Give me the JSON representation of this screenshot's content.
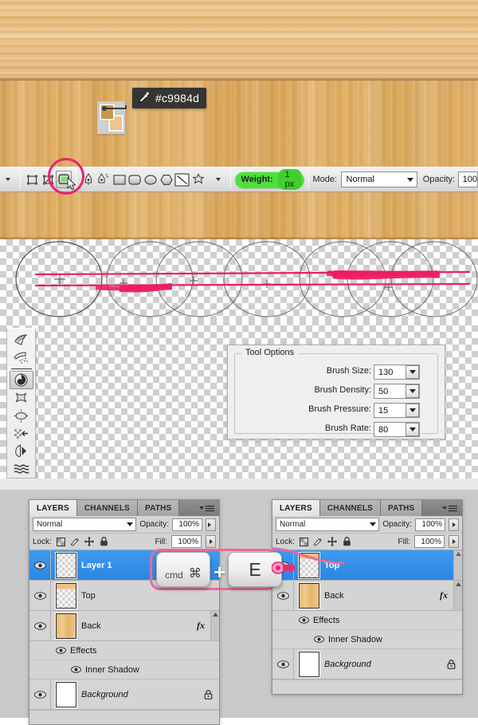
{
  "wood": {
    "top_color": "#eec08a",
    "main_color": "#dfad62"
  },
  "eyedropper": {
    "icon": "eyedropper-icon",
    "hex_value": "#c9984d",
    "foreground_color": "#c9984d",
    "background_color": "#eec58b"
  },
  "options_bar": {
    "preset_caret": "chevron-down-icon",
    "shape_tools": [
      {
        "name": "rectangular-marquee-tool",
        "selected": false
      },
      {
        "name": "transform-path-tool",
        "selected": false
      },
      {
        "name": "rounded-shape-tool",
        "selected": true
      },
      {
        "name": "pen-tool",
        "selected": false
      },
      {
        "name": "freeform-pen-tool",
        "selected": false
      },
      {
        "name": "rectangle-tool",
        "selected": false
      },
      {
        "name": "rounded-rectangle-tool",
        "selected": false
      },
      {
        "name": "ellipse-tool",
        "selected": false
      },
      {
        "name": "polygon-tool",
        "selected": false
      },
      {
        "name": "line-tool",
        "selected": false
      },
      {
        "name": "custom-shape-tool",
        "selected": false
      }
    ],
    "weight": {
      "label": "Weight:",
      "value": "1 px"
    },
    "mode": {
      "label": "Mode:",
      "value": "Normal"
    },
    "opacity": {
      "label": "Opacity:",
      "value": "100"
    }
  },
  "tool_palette": {
    "tools": [
      {
        "name": "forward-warp-tool",
        "selected": false
      },
      {
        "name": "reconstruct-tool",
        "selected": false
      },
      {
        "name": "twirl-clockwise-tool",
        "selected": true
      },
      {
        "name": "pucker-tool",
        "selected": false
      },
      {
        "name": "bloat-tool",
        "selected": false
      },
      {
        "name": "push-left-tool",
        "selected": false
      },
      {
        "name": "mirror-tool",
        "selected": false
      },
      {
        "name": "turbulence-tool",
        "selected": false
      }
    ]
  },
  "tool_options": {
    "title": "Tool Options",
    "fields": [
      {
        "label": "Brush Size:",
        "value": "130"
      },
      {
        "label": "Brush Density:",
        "value": "50"
      },
      {
        "label": "Brush Pressure:",
        "value": "15"
      },
      {
        "label": "Brush Rate:",
        "value": "80"
      }
    ]
  },
  "brush_preview": {
    "stroke_color": "#ec1d63",
    "cursor_count": 7,
    "crosshair_count": 6
  },
  "shortcut": {
    "key1_label": "cmd",
    "key1_glyph": "⌘",
    "separator": "+",
    "key2_label": "E",
    "highlight_color": "#e8699f"
  },
  "panel_left": {
    "tabs": [
      {
        "label": "LAYERS",
        "active": true
      },
      {
        "label": "CHANNELS",
        "active": false
      },
      {
        "label": "PATHS",
        "active": false
      }
    ],
    "menu_icon": "panel-menu-icon",
    "blend_mode": "Normal",
    "opacity_label": "Opacity:",
    "opacity_value": "100%",
    "lock_label": "Lock:",
    "lock_icons": [
      "lock-transparent-pixels-icon",
      "lock-image-pixels-icon",
      "lock-position-icon",
      "lock-all-icon"
    ],
    "fill_label": "Fill:",
    "fill_value": "100%",
    "layers": [
      {
        "name": "Layer 1",
        "thumb": "checker",
        "selected": true,
        "visible": true,
        "italic": false,
        "fx": false,
        "locked": false
      },
      {
        "name": "Top",
        "thumb": "half",
        "selected": false,
        "visible": true,
        "italic": false,
        "fx": false,
        "locked": false
      },
      {
        "name": "Back",
        "thumb": "wood",
        "selected": false,
        "visible": true,
        "italic": false,
        "fx": true,
        "locked": false
      },
      {
        "name": "Background",
        "thumb": "white",
        "selected": false,
        "visible": true,
        "italic": true,
        "fx": false,
        "locked": true
      }
    ],
    "effects_label": "Effects",
    "effect_items": [
      "Inner Shadow"
    ]
  },
  "panel_right": {
    "tabs": [
      {
        "label": "LAYERS",
        "active": true
      },
      {
        "label": "CHANNELS",
        "active": false
      },
      {
        "label": "PATHS",
        "active": false
      }
    ],
    "menu_icon": "panel-menu-icon",
    "blend_mode": "Normal",
    "opacity_label": "Opacity:",
    "opacity_value": "100%",
    "lock_label": "Lock:",
    "fill_label": "Fill:",
    "fill_value": "100%",
    "layers": [
      {
        "name": "Top",
        "thumb": "half",
        "selected": true,
        "visible": true,
        "italic": false,
        "fx": false,
        "locked": false
      },
      {
        "name": "Back",
        "thumb": "wood",
        "selected": false,
        "visible": true,
        "italic": false,
        "fx": true,
        "locked": false
      },
      {
        "name": "Background",
        "thumb": "white",
        "selected": false,
        "visible": true,
        "italic": true,
        "fx": false,
        "locked": true
      }
    ],
    "effects_label": "Effects",
    "effect_items": [
      "Inner Shadow"
    ]
  }
}
